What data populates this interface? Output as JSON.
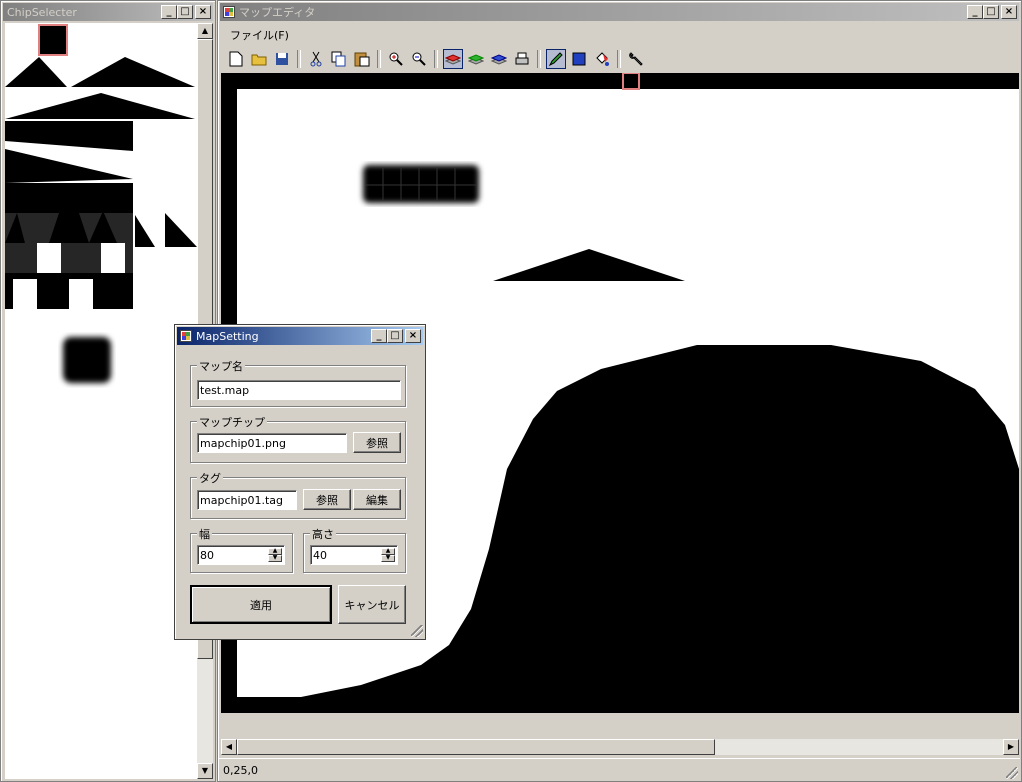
{
  "chip_selecter": {
    "title": "ChipSelecter"
  },
  "map_editor": {
    "title": "マップエディタ",
    "menu": {
      "file": "ファイル(F)"
    },
    "toolbar": [
      "new",
      "open",
      "save",
      "cut",
      "copy",
      "paste",
      "zoom-in",
      "zoom-out",
      "layer-red",
      "layer-green",
      "layer-blue",
      "layer-print",
      "pen",
      "fill-rect",
      "bucket",
      "settings"
    ],
    "status": "0,25,0"
  },
  "map_setting": {
    "title": "MapSetting",
    "map_name": {
      "label": "マップ名",
      "value": "test.map"
    },
    "map_chip": {
      "label": "マップチップ",
      "value": "mapchip01.png",
      "browse": "参照"
    },
    "tag": {
      "label": "タグ",
      "value": "mapchip01.tag",
      "browse": "参照",
      "edit": "編集"
    },
    "width": {
      "label": "幅",
      "value": "80"
    },
    "height": {
      "label": "高さ",
      "value": "40"
    },
    "apply": "適用",
    "cancel": "キャンセル"
  },
  "colors": {
    "active_title": "#0a246a",
    "inactive_title": "#808080",
    "selection": "#e08080"
  }
}
